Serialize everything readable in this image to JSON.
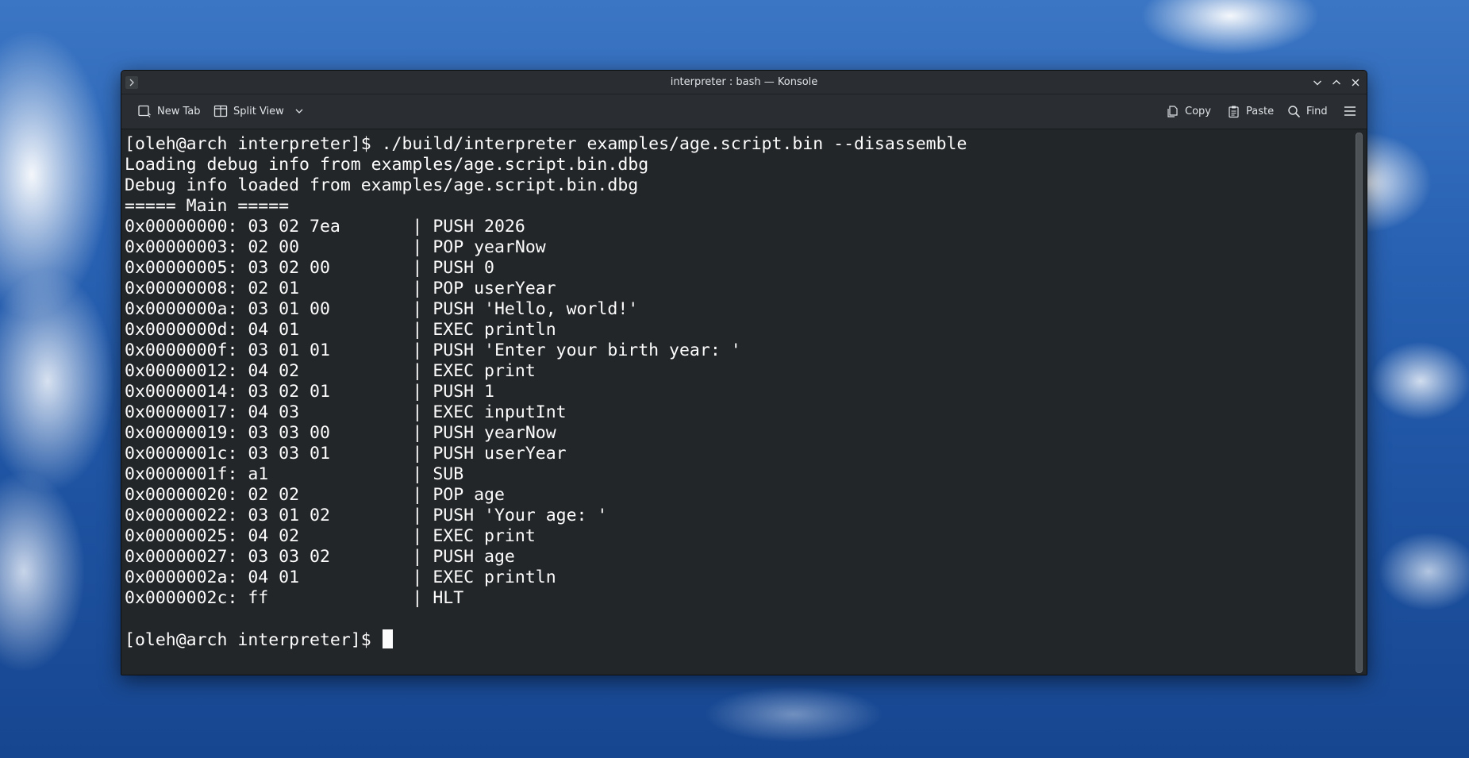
{
  "window": {
    "title": "interpreter : bash — Konsole"
  },
  "toolbar": {
    "new_tab_label": "New Tab",
    "split_view_label": "Split View",
    "copy_label": "Copy",
    "paste_label": "Paste",
    "find_label": "Find"
  },
  "terminal": {
    "lines": [
      "[oleh@arch interpreter]$ ./build/interpreter examples/age.script.bin --disassemble",
      "Loading debug info from examples/age.script.bin.dbg",
      "Debug info loaded from examples/age.script.bin.dbg",
      "===== Main =====",
      "0x00000000: 03 02 7ea       | PUSH 2026",
      "0x00000003: 02 00           | POP yearNow",
      "0x00000005: 03 02 00        | PUSH 0",
      "0x00000008: 02 01           | POP userYear",
      "0x0000000a: 03 01 00        | PUSH 'Hello, world!'",
      "0x0000000d: 04 01           | EXEC println",
      "0x0000000f: 03 01 01        | PUSH 'Enter your birth year: '",
      "0x00000012: 04 02           | EXEC print",
      "0x00000014: 03 02 01        | PUSH 1",
      "0x00000017: 04 03           | EXEC inputInt",
      "0x00000019: 03 03 00        | PUSH yearNow",
      "0x0000001c: 03 03 01        | PUSH userYear",
      "0x0000001f: a1              | SUB",
      "0x00000020: 02 02           | POP age",
      "0x00000022: 03 01 02        | PUSH 'Your age: '",
      "0x00000025: 04 02           | EXEC print",
      "0x00000027: 03 03 02        | PUSH age",
      "0x0000002a: 04 01           | EXEC println",
      "0x0000002c: ff              | HLT",
      ""
    ],
    "prompt": "[oleh@arch interpreter]$ "
  }
}
